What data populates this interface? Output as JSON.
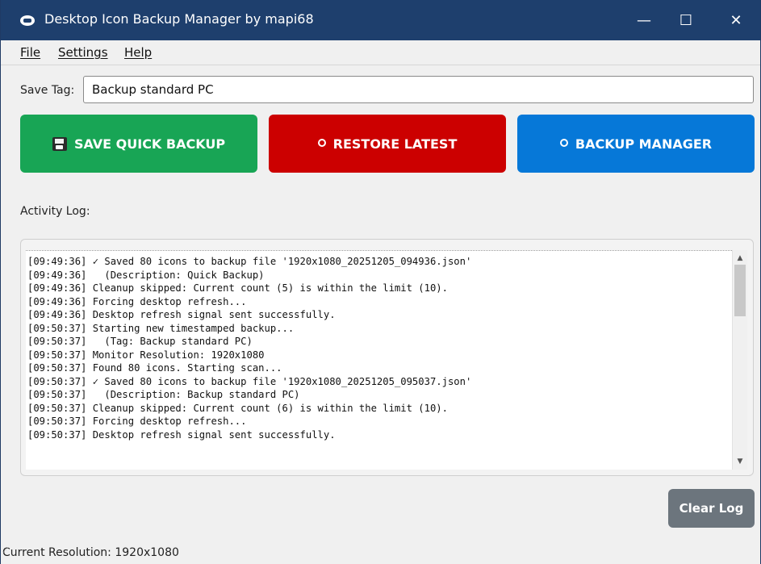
{
  "window": {
    "title": "Desktop Icon Backup Manager by mapi68",
    "controls": {
      "minimize": "—",
      "maximize": "☐",
      "close": "✕"
    }
  },
  "menu": [
    {
      "label": "File"
    },
    {
      "label": "Settings"
    },
    {
      "label": "Help"
    }
  ],
  "save_tag": {
    "label": "Save Tag:",
    "value": "Backup standard PC"
  },
  "buttons": {
    "save_quick_backup": {
      "label": "SAVE QUICK BACKUP",
      "color": "#18a555"
    },
    "restore_latest": {
      "label": "RESTORE LATEST",
      "color": "#cc0000"
    },
    "backup_manager": {
      "label": "BACKUP MANAGER",
      "color": "#0678d8"
    },
    "clear_log": {
      "label": "Clear Log",
      "color": "#6c757d"
    }
  },
  "activity_log": {
    "label": "Activity Log:",
    "lines": [
      "[09:49:36] ✓ Saved 80 icons to backup file '1920x1080_20251205_094936.json'",
      "[09:49:36]   (Description: Quick Backup)",
      "[09:49:36] Cleanup skipped: Current count (5) is within the limit (10).",
      "[09:49:36] Forcing desktop refresh...",
      "[09:49:36] Desktop refresh signal sent successfully.",
      "[09:50:37] Starting new timestamped backup...",
      "[09:50:37]   (Tag: Backup standard PC)",
      "[09:50:37] Monitor Resolution: 1920x1080",
      "[09:50:37] Found 80 icons. Starting scan...",
      "[09:50:37] ✓ Saved 80 icons to backup file '1920x1080_20251205_095037.json'",
      "[09:50:37]   (Description: Backup standard PC)",
      "[09:50:37] Cleanup skipped: Current count (6) is within the limit (10).",
      "[09:50:37] Forcing desktop refresh...",
      "[09:50:37] Desktop refresh signal sent successfully."
    ]
  },
  "status_bar": {
    "text": "Current Resolution: 1920x1080"
  }
}
